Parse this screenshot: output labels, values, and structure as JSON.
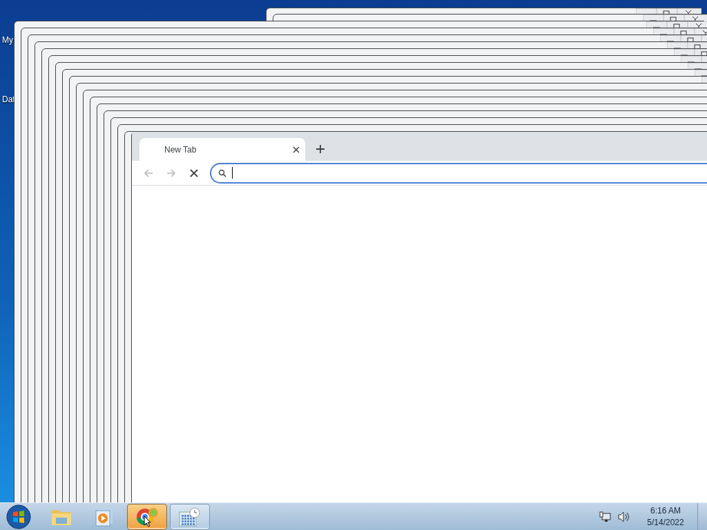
{
  "desktop_icons": [
    {
      "label": "My"
    },
    {
      "label": "Dat"
    }
  ],
  "browser": {
    "tabs": [
      {
        "title": "New Tab",
        "selected": true
      }
    ],
    "nav": [
      {
        "kind": "back",
        "disabled": true
      },
      {
        "kind": "forward",
        "disabled": true
      },
      {
        "kind": "stop",
        "disabled": false
      }
    ],
    "omnibox": {
      "focused": true
    }
  },
  "taskbar": {
    "buttons": [
      {
        "kind": "explorer",
        "running": false,
        "selected": false
      },
      {
        "kind": "media",
        "running": false,
        "selected": false
      },
      {
        "kind": "browser",
        "running": true,
        "selected": true
      },
      {
        "kind": "calendar",
        "running": true,
        "selected": false
      }
    ],
    "clock": {
      "time": "6:16 AM",
      "date": "5/14/2022"
    }
  }
}
